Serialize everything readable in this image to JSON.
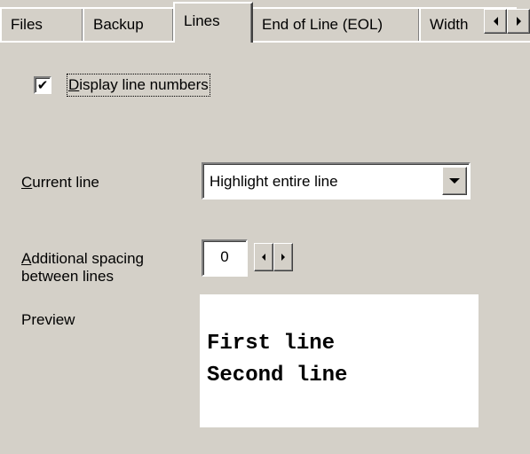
{
  "tabs": [
    {
      "label": "Files"
    },
    {
      "label": "Backup"
    },
    {
      "label": "Lines",
      "active": true
    },
    {
      "label": "End of Line (EOL)"
    },
    {
      "label": "Width"
    }
  ],
  "tab_scroll": {
    "left_icon": "arrow-left-icon",
    "right_icon": "arrow-right-icon"
  },
  "display_line_numbers": {
    "checked": true,
    "check_glyph": "✔",
    "mnemonic": "D",
    "label_rest": "isplay line numbers"
  },
  "current_line": {
    "mnemonic": "C",
    "label_rest": "urrent line",
    "selected": "Highlight entire line",
    "dropdown_icon": "chevron-down-icon"
  },
  "spacing": {
    "mnemonic": "A",
    "label_line1_rest": "dditional spacing",
    "label_line2": "between lines",
    "value": "0"
  },
  "preview": {
    "label": "Preview",
    "lines": [
      "First line",
      "Second line"
    ]
  },
  "colors": {
    "face": "#d4d0c8",
    "highlight": "#ffffff",
    "shadow": "#808080",
    "dark_shadow": "#404040",
    "field": "#ffffff"
  }
}
